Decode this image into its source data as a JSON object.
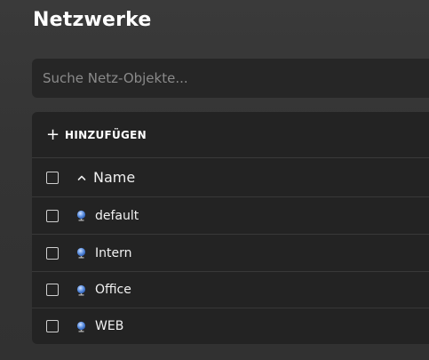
{
  "page": {
    "title": "Netzwerke"
  },
  "search": {
    "placeholder": "Suche Netz-Objekte..."
  },
  "toolbar": {
    "add_label": "HINZUFÜGEN",
    "add_icon": "plus-icon"
  },
  "table": {
    "columns": [
      {
        "label": "Name",
        "sort": "ascending",
        "sort_icon": "chevron-up-icon"
      }
    ],
    "rows": [
      {
        "name": "default",
        "icon": "network-globe-icon"
      },
      {
        "name": "Intern",
        "icon": "network-globe-icon"
      },
      {
        "name": "Office",
        "icon": "network-globe-icon"
      },
      {
        "name": "WEB",
        "icon": "network-globe-icon"
      }
    ]
  },
  "colors": {
    "background": "#363636",
    "card": "#232323",
    "input": "#262626",
    "icon_blue": "#5b8fe0"
  }
}
